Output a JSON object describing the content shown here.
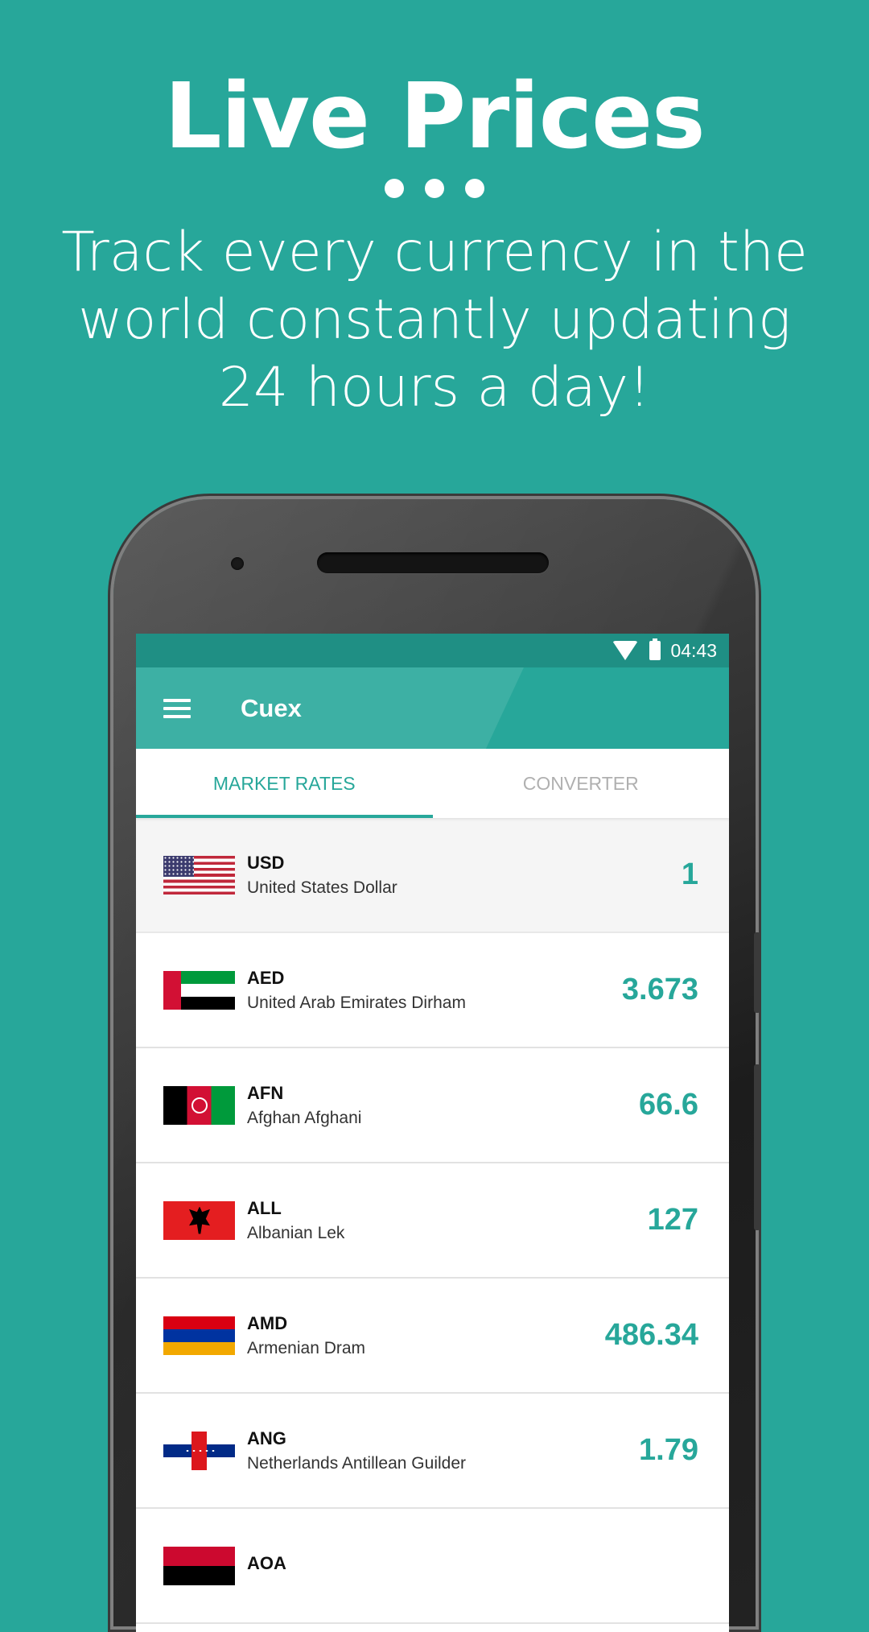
{
  "promo": {
    "headline": "Live Prices",
    "subtitle_lines": [
      "Track every currency in the",
      "world constantly updating",
      "24 hours a day!"
    ]
  },
  "statusbar": {
    "time": "04:43"
  },
  "appbar": {
    "title": "Cuex",
    "menu_icon": "hamburger-menu-icon"
  },
  "tabs": [
    {
      "label": "MARKET RATES",
      "active": true
    },
    {
      "label": "CONVERTER",
      "active": false
    }
  ],
  "currencies": [
    {
      "code": "USD",
      "name": "United States Dollar",
      "value": "1",
      "flag": "us-flag-icon"
    },
    {
      "code": "AED",
      "name": "United Arab Emirates Dirham",
      "value": "3.673",
      "flag": "uae-flag-icon"
    },
    {
      "code": "AFN",
      "name": "Afghan Afghani",
      "value": "66.6",
      "flag": "afghanistan-flag-icon"
    },
    {
      "code": "ALL",
      "name": "Albanian Lek",
      "value": "127",
      "flag": "albania-flag-icon"
    },
    {
      "code": "AMD",
      "name": "Armenian Dram",
      "value": "486.34",
      "flag": "armenia-flag-icon"
    },
    {
      "code": "ANG",
      "name": "Netherlands Antillean Guilder",
      "value": "1.79",
      "flag": "netherlands-antilles-flag-icon"
    },
    {
      "code": "AOA",
      "name": "",
      "value": "",
      "flag": "angola-flag-icon"
    }
  ],
  "colors": {
    "accent": "#27a79a",
    "statusbar": "#1f8f84",
    "background": "#27a79a"
  }
}
